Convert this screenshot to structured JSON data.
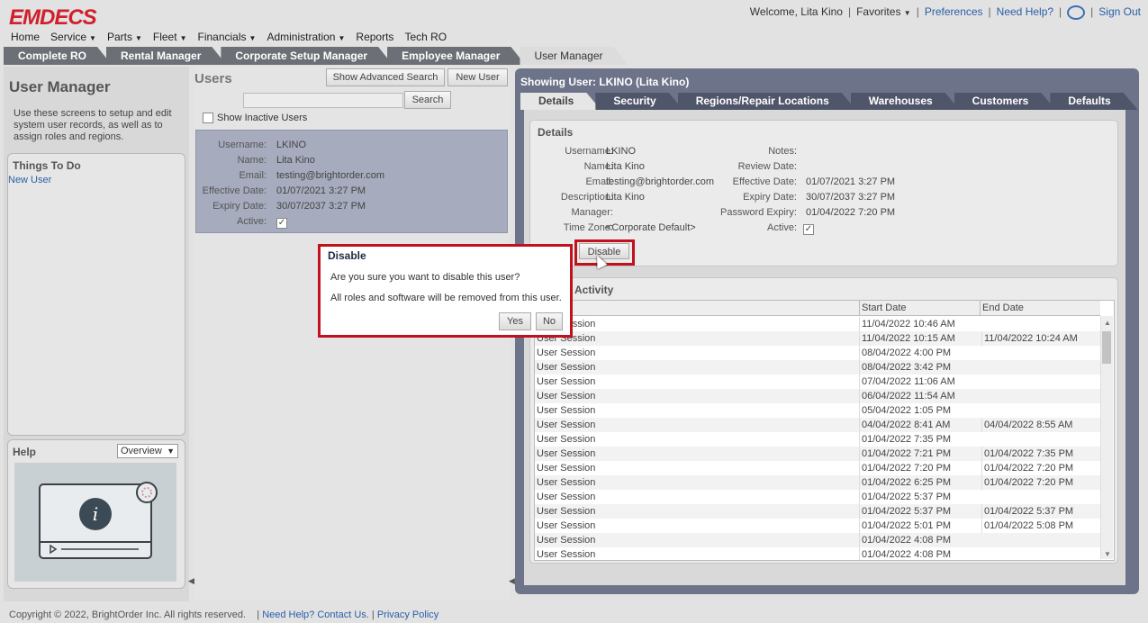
{
  "brand": {
    "logo": "EMDECS"
  },
  "header": {
    "welcome": "Welcome, Lita Kino",
    "favorites": "Favorites",
    "preferences": "Preferences",
    "need_help": "Need Help?",
    "sign_out": "Sign Out"
  },
  "nav": [
    "Home",
    "Service",
    "Parts",
    "Fleet",
    "Financials",
    "Administration",
    "Reports",
    "Tech RO"
  ],
  "app_tabs": [
    "Complete RO",
    "Rental Manager",
    "Corporate Setup Manager",
    "Employee Manager",
    "User Manager"
  ],
  "left": {
    "title": "User Manager",
    "description": "Use these screens to setup and edit system user records, as well as to assign roles and regions.",
    "todo_title": "Things To Do",
    "todo_link": "New User",
    "help_title": "Help",
    "help_select": "Overview"
  },
  "users": {
    "title": "Users",
    "adv_search": "Show Advanced Search",
    "new_user": "New User",
    "search_btn": "Search",
    "search_value": "",
    "show_inactive": "Show Inactive Users",
    "card": {
      "username_label": "Username:",
      "username": "LKINO",
      "name_label": "Name:",
      "name": "Lita Kino",
      "email_label": "Email:",
      "email": "testing@brightorder.com",
      "eff_label": "Effective Date:",
      "eff": "01/07/2021 3:27 PM",
      "exp_label": "Expiry Date:",
      "exp": "30/07/2037 3:27 PM",
      "active_label": "Active:"
    }
  },
  "right": {
    "showing": "Showing User: LKINO (Lita Kino)",
    "tabs": [
      "Details",
      "Security",
      "Regions/Repair Locations",
      "Warehouses",
      "Customers",
      "Defaults"
    ],
    "details_title": "Details",
    "left_fields": [
      {
        "label": "Username:",
        "value": "LKINO"
      },
      {
        "label": "Name:",
        "value": "Lita Kino"
      },
      {
        "label": "Email:",
        "value": "testing@brightorder.com"
      },
      {
        "label": "Description:",
        "value": "Lita Kino"
      },
      {
        "label": "Manager:",
        "value": ""
      },
      {
        "label": "Time Zone:",
        "value": "<Corporate Default>"
      }
    ],
    "right_fields": [
      {
        "label": "Notes:",
        "value": ""
      },
      {
        "label": "Review Date:",
        "value": ""
      },
      {
        "label": "Effective Date:",
        "value": "01/07/2021 3:27 PM"
      },
      {
        "label": "Expiry Date:",
        "value": "30/07/2037 3:27 PM"
      },
      {
        "label": "Password Expiry:",
        "value": "01/04/2022 7:20 PM"
      },
      {
        "label": "Active:",
        "value": ""
      }
    ],
    "disable_btn": "Disable",
    "activity_title": "Activity",
    "activity_headers": [
      "",
      "Start Date",
      "End Date"
    ],
    "activity": [
      [
        "User Session",
        "11/04/2022 10:46 AM",
        ""
      ],
      [
        "User Session",
        "11/04/2022 10:15 AM",
        "11/04/2022 10:24 AM"
      ],
      [
        "User Session",
        "08/04/2022 4:00 PM",
        ""
      ],
      [
        "User Session",
        "08/04/2022 3:42 PM",
        ""
      ],
      [
        "User Session",
        "07/04/2022 11:06 AM",
        ""
      ],
      [
        "User Session",
        "06/04/2022 11:54 AM",
        ""
      ],
      [
        "User Session",
        "05/04/2022 1:05 PM",
        ""
      ],
      [
        "User Session",
        "04/04/2022 8:41 AM",
        "04/04/2022 8:55 AM"
      ],
      [
        "User Session",
        "01/04/2022 7:35 PM",
        ""
      ],
      [
        "User Session",
        "01/04/2022 7:21 PM",
        "01/04/2022 7:35 PM"
      ],
      [
        "User Session",
        "01/04/2022 7:20 PM",
        "01/04/2022 7:20 PM"
      ],
      [
        "User Session",
        "01/04/2022 6:25 PM",
        "01/04/2022 7:20 PM"
      ],
      [
        "User Session",
        "01/04/2022 5:37 PM",
        ""
      ],
      [
        "User Session",
        "01/04/2022 5:37 PM",
        "01/04/2022 5:37 PM"
      ],
      [
        "User Session",
        "01/04/2022 5:01 PM",
        "01/04/2022 5:08 PM"
      ],
      [
        "User Session",
        "01/04/2022 4:08 PM",
        ""
      ],
      [
        "User Session",
        "01/04/2022 4:08 PM",
        ""
      ]
    ]
  },
  "dialog": {
    "title": "Disable",
    "question": "Are you sure you want to disable this user?",
    "note": "All roles and software will be removed from this user.",
    "yes": "Yes",
    "no": "No"
  },
  "footer": {
    "copyright": "Copyright © 2022, BrightOrder Inc. All rights reserved.",
    "help": "Need Help? Contact Us.",
    "privacy": "Privacy Policy"
  },
  "colors": {
    "brand_red": "#d0202c",
    "highlight_red": "#c0111c",
    "link_blue": "#2a5ea8",
    "panel_blue": "#6d7489"
  }
}
